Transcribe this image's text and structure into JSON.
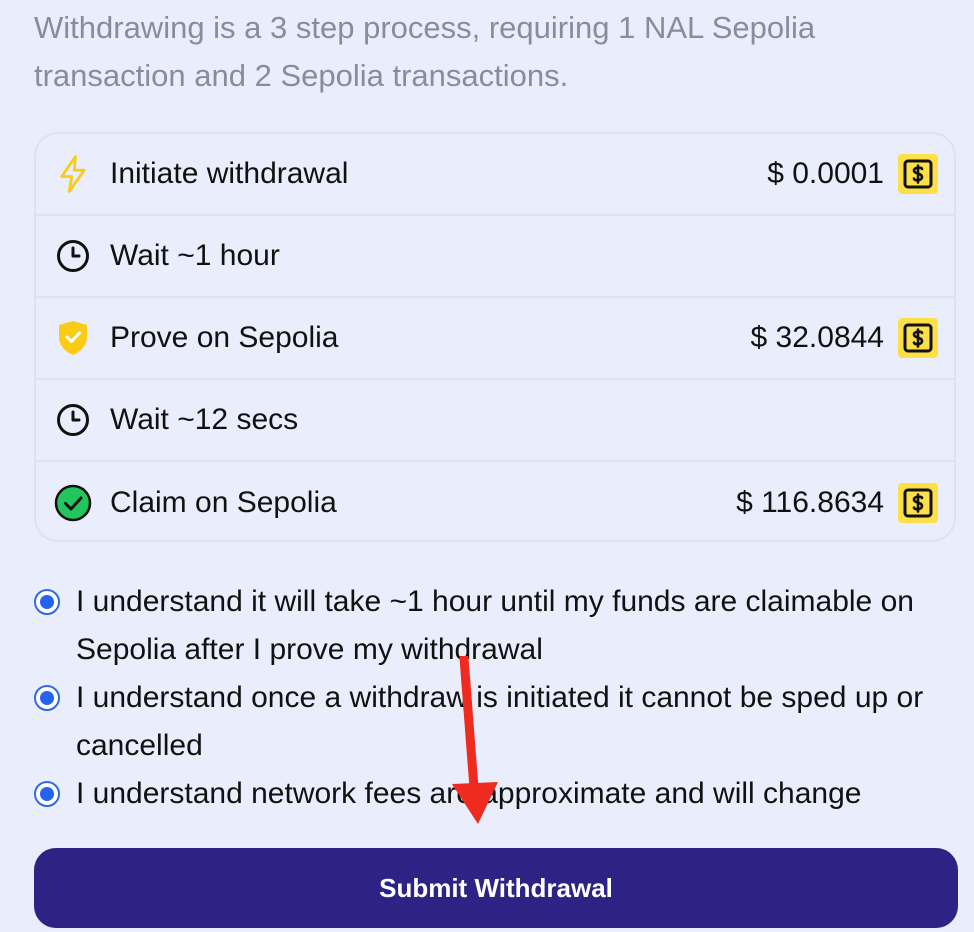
{
  "intro": {
    "text": "Withdrawing is a 3 step process, requiring 1 NAL Sepolia transaction and 2 Sepolia transactions."
  },
  "steps": [
    {
      "icon": "lightning-icon",
      "label": "Initiate withdrawal",
      "cost": "$ 0.0001",
      "has_fee": true
    },
    {
      "icon": "clock-icon",
      "label": "Wait ~1 hour",
      "cost": "",
      "has_fee": false
    },
    {
      "icon": "shield-check-icon",
      "label": "Prove on Sepolia",
      "cost": "$ 32.0844",
      "has_fee": true
    },
    {
      "icon": "clock-icon",
      "label": "Wait ~12 secs",
      "cost": "",
      "has_fee": false
    },
    {
      "icon": "check-circle-icon",
      "label": "Claim on Sepolia",
      "cost": "$ 116.8634",
      "has_fee": true
    }
  ],
  "acknowledgements": [
    {
      "label": "I understand it will take ~1 hour until my funds are claimable on Sepolia after I prove my withdrawal",
      "checked": true
    },
    {
      "label": "I understand once a withdraw is initiated it cannot be sped up or cancelled",
      "checked": true
    },
    {
      "label": "I understand network fees are approximate and will change",
      "checked": true
    }
  ],
  "submit": {
    "label": "Submit Withdrawal"
  },
  "colors": {
    "background": "#eaedfc",
    "accent": "#2e2384",
    "fee_badge": "#fde047",
    "radio": "#2563eb",
    "annotation_arrow": "#ef2b1f"
  }
}
